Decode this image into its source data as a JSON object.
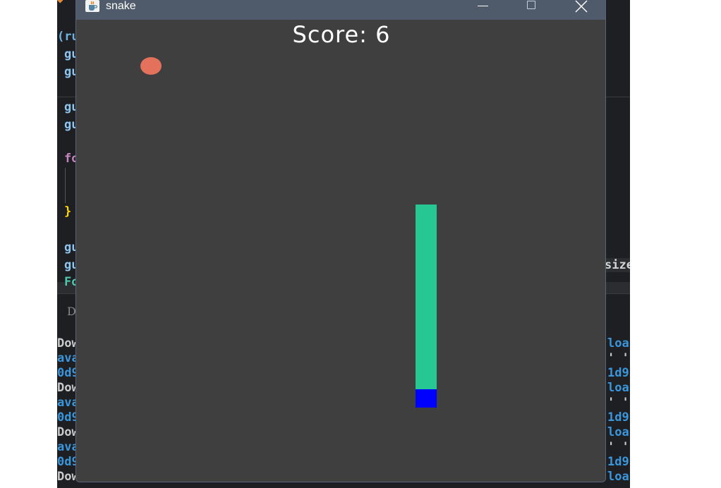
{
  "window": {
    "title": "snake",
    "icon": "java-coffee-cup-icon",
    "controls": [
      "minimize-icon",
      "maximize-icon",
      "close-icon"
    ]
  },
  "game": {
    "score_text": "Score: 6",
    "score": 6
  },
  "background_ide": {
    "code_fragments": [
      "(ru",
      "gu",
      "gu",
      "gu",
      "gu",
      "fo",
      "}",
      "gu",
      "gu",
      "Fo",
      "size"
    ],
    "terminal_left": [
      "D",
      "Dow",
      "ava",
      "0d9",
      "Dow",
      "ava",
      "0d9",
      "Dow",
      "ava",
      "0d9",
      "Dow"
    ],
    "terminal_right": [
      "loa",
      "' '",
      "1d9",
      "loa",
      "' '",
      "1d9",
      "loa",
      "' '",
      "1d9",
      "loa"
    ]
  },
  "colors": {
    "game_background": "#3f3f3f",
    "titlebar": "#4f5b6a",
    "snake_body": "#26c793",
    "snake_head": "#0000ff",
    "food": "#e4715b",
    "text": "#ffffff"
  }
}
